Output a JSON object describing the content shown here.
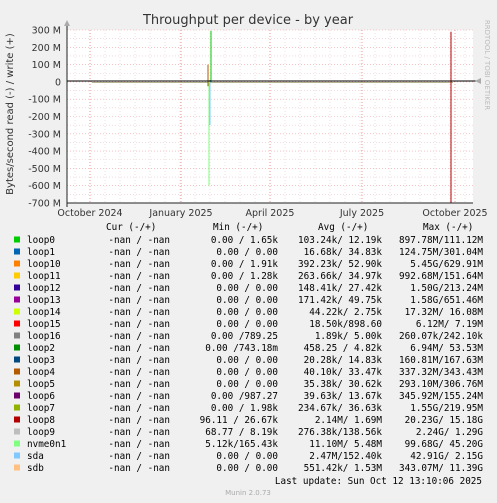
{
  "chart_data": {
    "type": "line",
    "title": "Throughput per device - by year",
    "ylabel": "Bytes/second read (-) / write (+)",
    "watermark": "RRDTOOL / TOBI OETIKER",
    "ylim": [
      -700000000,
      300000000
    ],
    "y_ticks": [
      {
        "value": 300000000,
        "label": "300 M"
      },
      {
        "value": 200000000,
        "label": "200 M"
      },
      {
        "value": 100000000,
        "label": "100 M"
      },
      {
        "value": 0,
        "label": "0"
      },
      {
        "value": -100000000,
        "label": "-100 M"
      },
      {
        "value": -200000000,
        "label": "-200 M"
      },
      {
        "value": -300000000,
        "label": "-300 M"
      },
      {
        "value": -400000000,
        "label": "-400 M"
      },
      {
        "value": -500000000,
        "label": "-500 M"
      },
      {
        "value": -600000000,
        "label": "-600 M"
      },
      {
        "value": -700000000,
        "label": "-700 M"
      }
    ],
    "x_ticks": [
      "October 2024",
      "January 2025",
      "April 2025",
      "July 2025",
      "October 2025"
    ],
    "grid": true,
    "legend_placement": "bottom",
    "spikes": [
      {
        "series": "loop0",
        "x": "January 2025",
        "write": 295000000,
        "read": 0
      },
      {
        "series": "loop1",
        "x": "January 2025",
        "write": 10000000,
        "read": -110000000
      },
      {
        "series": "loop4",
        "x": "January 2025",
        "write": 100000000,
        "read": -25000000
      },
      {
        "series": "nvme0n1",
        "x": "January 2025",
        "write": 0,
        "read": -600000000
      },
      {
        "series": "sda",
        "x": "January 2025",
        "write": 0,
        "read": -250000000
      },
      {
        "series": "loop8",
        "x": "October 2025",
        "write": 290000000,
        "read": -700000000
      }
    ],
    "columns": {
      "cur": "Cur (-/+)",
      "min": "Min (-/+)",
      "avg": "Avg (-/+)",
      "max": "Max (-/+)"
    },
    "series": [
      {
        "name": "loop0",
        "color": "#00cc00",
        "cur": "-nan /  -nan",
        "min": "0.00 /  1.65k",
        "avg": "103.24k/ 12.19k",
        "max": "897.78M/111.12M"
      },
      {
        "name": "loop1",
        "color": "#0066b3",
        "cur": "-nan /  -nan",
        "min": "0.00 /  0.00",
        "avg": "16.68k/ 34.83k",
        "max": "124.75M/301.04M"
      },
      {
        "name": "loop10",
        "color": "#ff8000",
        "cur": "-nan /  -nan",
        "min": "0.00 /  1.91k",
        "avg": "392.23k/ 52.90k",
        "max": "5.45G/629.91M"
      },
      {
        "name": "loop11",
        "color": "#ffcc00",
        "cur": "-nan /  -nan",
        "min": "0.00 /  1.28k",
        "avg": "263.66k/ 34.97k",
        "max": "992.68M/151.64M"
      },
      {
        "name": "loop12",
        "color": "#330099",
        "cur": "-nan /  -nan",
        "min": "0.00 /  0.00",
        "avg": "148.41k/ 27.42k",
        "max": "1.50G/213.24M"
      },
      {
        "name": "loop13",
        "color": "#990099",
        "cur": "-nan /  -nan",
        "min": "0.00 /  0.00",
        "avg": "171.42k/ 49.75k",
        "max": "1.58G/651.46M"
      },
      {
        "name": "loop14",
        "color": "#ccff00",
        "cur": "-nan /  -nan",
        "min": "0.00 /  0.00",
        "avg": "44.22k/  2.75k",
        "max": "17.32M/ 16.08M"
      },
      {
        "name": "loop15",
        "color": "#ff0000",
        "cur": "-nan /  -nan",
        "min": "0.00 /  0.00",
        "avg": "18.50k/898.60",
        "max": "6.12M/  7.19M"
      },
      {
        "name": "loop16",
        "color": "#808080",
        "cur": "-nan /  -nan",
        "min": "0.00 /789.25",
        "avg": "1.89k/  5.00k",
        "max": "260.07k/242.10k"
      },
      {
        "name": "loop2",
        "color": "#008f00",
        "cur": "-nan /  -nan",
        "min": "0.00 /743.18m",
        "avg": "458.25 /  4.82k",
        "max": "6.94M/ 53.53M"
      },
      {
        "name": "loop3",
        "color": "#00487d",
        "cur": "-nan /  -nan",
        "min": "0.00 /  0.00",
        "avg": "20.28k/ 14.83k",
        "max": "160.81M/167.63M"
      },
      {
        "name": "loop4",
        "color": "#b35a00",
        "cur": "-nan /  -nan",
        "min": "0.00 /  0.00",
        "avg": "40.10k/ 33.47k",
        "max": "337.32M/343.43M"
      },
      {
        "name": "loop5",
        "color": "#b38f00",
        "cur": "-nan /  -nan",
        "min": "0.00 /  0.00",
        "avg": "35.38k/ 30.62k",
        "max": "293.10M/306.76M"
      },
      {
        "name": "loop6",
        "color": "#6b006b",
        "cur": "-nan /  -nan",
        "min": "0.00 /987.27",
        "avg": "39.63k/ 13.67k",
        "max": "345.92M/155.24M"
      },
      {
        "name": "loop7",
        "color": "#8fb300",
        "cur": "-nan /  -nan",
        "min": "0.00 /  1.98k",
        "avg": "234.67k/ 36.63k",
        "max": "1.55G/219.95M"
      },
      {
        "name": "loop8",
        "color": "#b30000",
        "cur": "-nan /  -nan",
        "min": "96.11 /  26.67k",
        "avg": "2.14M/  1.69M",
        "max": "20.23G/ 15.18G"
      },
      {
        "name": "loop9",
        "color": "#bebebe",
        "cur": "-nan /  -nan",
        "min": "68.77 /  8.19k",
        "avg": "276.38k/138.56k",
        "max": "2.24G/  1.29G"
      },
      {
        "name": "nvme0n1",
        "color": "#80ff80",
        "cur": "-nan /  -nan",
        "min": "5.12k/165.43k",
        "avg": "11.10M/  5.48M",
        "max": "99.68G/ 45.20G"
      },
      {
        "name": "sda",
        "color": "#80c9ff",
        "cur": "-nan /  -nan",
        "min": "0.00 /  0.00",
        "avg": "2.47M/152.40k",
        "max": "42.91G/  2.15G"
      },
      {
        "name": "sdb",
        "color": "#ffc080",
        "cur": "-nan /  -nan",
        "min": "0.00 /  0.00",
        "avg": "551.42k/  1.53M",
        "max": "343.07M/ 11.39G"
      }
    ]
  },
  "footer": {
    "last_update": "Last update: Sun Oct 12 13:10:06 2025",
    "version": "Munin 2.0.73"
  }
}
